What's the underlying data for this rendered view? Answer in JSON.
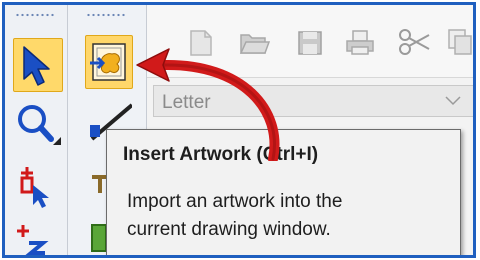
{
  "colors": {
    "frame_border": "#1f5fbf",
    "active_tool_fill": "#ffd76a",
    "annotation_arrow": "#d11a1a",
    "tooltip_background": "#f2f2f2"
  },
  "toolbox": {
    "tools": [
      {
        "icon": "select-arrow-icon",
        "state": "active"
      },
      {
        "icon": "zoom-magnifier-icon"
      },
      {
        "icon": "pick-tool-icon"
      },
      {
        "icon": "count-tool-icon"
      }
    ],
    "drawing_tools": [
      {
        "icon": "insert-artwork-icon",
        "state": "highlighted"
      },
      {
        "icon": "line-tool-icon"
      }
    ]
  },
  "toolbar": {
    "icons": [
      "new-document-icon",
      "open-folder-icon",
      "save-disk-icon",
      "print-icon",
      "cut-scissors-icon",
      "copy-icon"
    ]
  },
  "paper_size": {
    "value": "Letter"
  },
  "tooltip": {
    "title": "Insert Artwork (Ctrl+I)",
    "line1": "Import an artwork into the",
    "line2": "current drawing window."
  }
}
